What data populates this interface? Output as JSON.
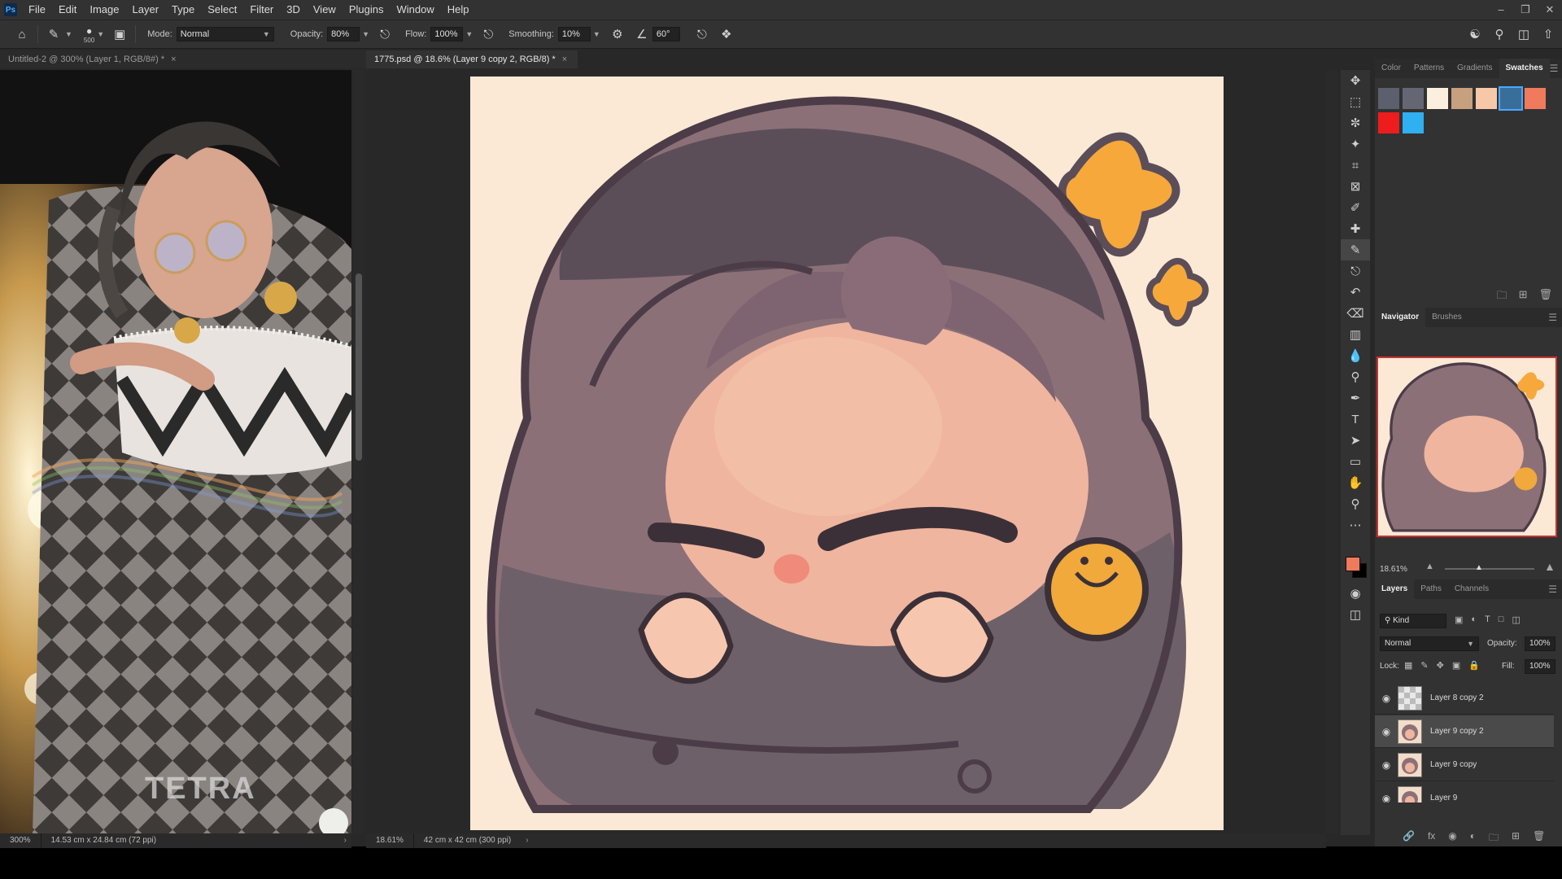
{
  "app": {
    "logo": "Ps"
  },
  "menu": [
    "File",
    "Edit",
    "Image",
    "Layer",
    "Type",
    "Select",
    "Filter",
    "3D",
    "View",
    "Plugins",
    "Window",
    "Help"
  ],
  "window_controls": [
    "minimize-icon",
    "restore-icon",
    "close-icon"
  ],
  "options": {
    "brush_size": "500",
    "mode_label": "Mode:",
    "mode_value": "Normal",
    "opacity_label": "Opacity:",
    "opacity_value": "80%",
    "flow_label": "Flow:",
    "flow_value": "100%",
    "smoothing_label": "Smoothing:",
    "smoothing_value": "10%",
    "angle_value": "60°"
  },
  "tabs": [
    {
      "label": "Untitled-2 @ 300% (Layer 1, RGB/8#) *",
      "close": "×"
    },
    {
      "label": "1775.psd @ 18.6% (Layer 9 copy 2, RGB/8) *",
      "close": "×"
    }
  ],
  "doc1": {
    "zoom": "300%",
    "info": "14.53 cm x 24.84 cm (72 ppi)",
    "watermark": "TETRA"
  },
  "doc2": {
    "zoom": "18.61%",
    "info": "42 cm x 42 cm (300 ppi)"
  },
  "swatches_panel": {
    "tabs": [
      "Color",
      "Patterns",
      "Gradients",
      "Swatches"
    ],
    "active": "Swatches",
    "colors": [
      "#5c5f6e",
      "#646674",
      "#fbf0de",
      "#c7a07f",
      "#f6c8a8",
      "#3a6e9a",
      "#f07a5c",
      "#ee1c1c",
      "#2fb0f0"
    ]
  },
  "navigator_panel": {
    "tabs": [
      "Navigator",
      "Brushes"
    ],
    "active": "Navigator",
    "zoom": "18.61%"
  },
  "layers_panel": {
    "tabs": [
      "Layers",
      "Paths",
      "Channels"
    ],
    "active": "Layers",
    "kind_label": "Kind",
    "blend_mode": "Normal",
    "opacity_label": "Opacity:",
    "opacity_value": "100%",
    "lock_label": "Lock:",
    "fill_label": "Fill:",
    "fill_value": "100%",
    "layers": [
      {
        "name": "Layer 8 copy 2",
        "visible": true,
        "selected": false
      },
      {
        "name": "Layer 9 copy 2",
        "visible": true,
        "selected": true
      },
      {
        "name": "Layer 9 copy",
        "visible": true,
        "selected": false
      },
      {
        "name": "Layer 9",
        "visible": true,
        "selected": false
      }
    ]
  },
  "toolbar_tools": [
    "move-icon",
    "marquee-icon",
    "lasso-icon",
    "magic-wand-icon",
    "crop-icon",
    "frame-icon",
    "eyedropper-icon",
    "healing-icon",
    "brush-icon",
    "stamp-icon",
    "history-brush-icon",
    "eraser-icon",
    "bucket-icon",
    "blur-icon",
    "dodge-icon",
    "pen-icon",
    "type-icon",
    "path-select-icon",
    "rectangle-icon",
    "hand-icon",
    "zoom-icon",
    "more-icon"
  ],
  "colors": {
    "foreground": "#f07a5c",
    "background": "#000000",
    "accent": "#3a6e9a"
  }
}
